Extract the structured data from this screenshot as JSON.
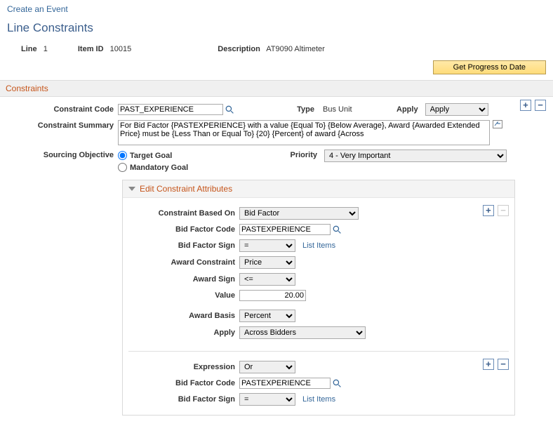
{
  "header": {
    "breadcrumb": "Create an Event",
    "title": "Line Constraints"
  },
  "info": {
    "line_lbl": "Line",
    "line_val": "1",
    "item_lbl": "Item ID",
    "item_val": "10015",
    "desc_lbl": "Description",
    "desc_val": "AT9090 Altimeter"
  },
  "buttons": {
    "progress": "Get Progress to Date"
  },
  "section": {
    "constraints": "Constraints"
  },
  "constraint": {
    "code_lbl": "Constraint Code",
    "code_val": "PAST_EXPERIENCE",
    "type_lbl": "Type",
    "type_val": "Bus Unit",
    "apply_lbl": "Apply",
    "apply_val": "Apply",
    "summary_lbl": "Constraint Summary",
    "summary_val": "For Bid Factor {PASTEXPERIENCE} with a value {Equal To} {Below Average}, Award {Awarded Extended Price} must be {Less Than or Equal To} {20} {Percent} of award {Across",
    "sourcing_lbl": "Sourcing Objective",
    "radio_target": "Target Goal",
    "radio_mandatory": "Mandatory Goal",
    "priority_lbl": "Priority",
    "priority_val": "4 - Very Important"
  },
  "attr": {
    "header": "Edit Constraint Attributes",
    "based_on_lbl": "Constraint Based On",
    "based_on_val": "Bid Factor",
    "bf_code_lbl": "Bid Factor Code",
    "bf_code_val": "PASTEXPERIENCE",
    "bf_sign_lbl": "Bid Factor Sign",
    "bf_sign_val": "=",
    "list_items": "List Items",
    "award_constraint_lbl": "Award Constraint",
    "award_constraint_val": "Price",
    "award_sign_lbl": "Award Sign",
    "award_sign_val": "<=",
    "value_lbl": "Value",
    "value_val": "20.00",
    "award_basis_lbl": "Award Basis",
    "award_basis_val": "Percent",
    "apply_lbl": "Apply",
    "apply_val": "Across Bidders",
    "expression_lbl": "Expression",
    "expression_val": "Or",
    "bf_code2_val": "PASTEXPERIENCE",
    "bf_sign2_val": "="
  }
}
